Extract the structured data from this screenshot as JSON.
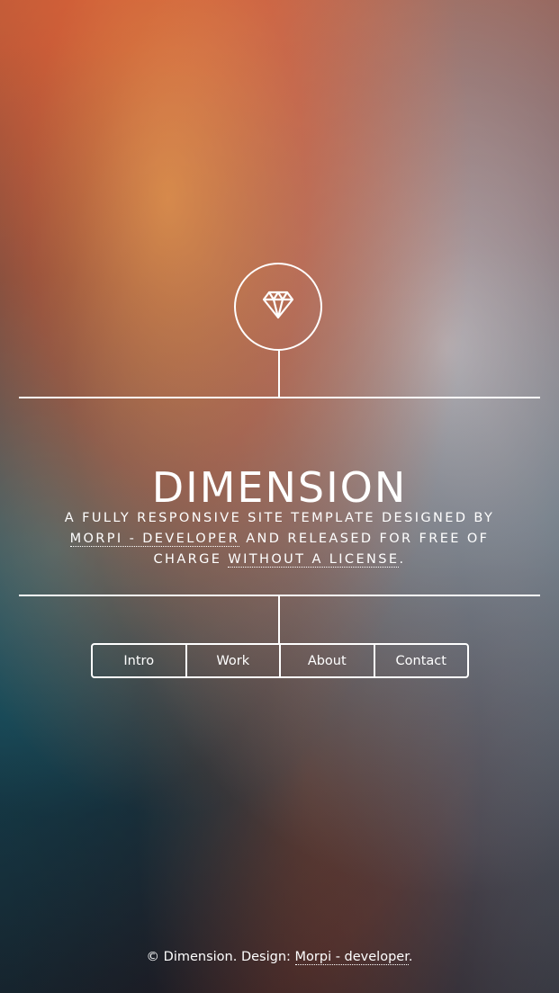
{
  "site": {
    "logo_icon": "diamond-icon",
    "title": "DIMENSION",
    "description": {
      "part1": "A fully responsive site template designed by ",
      "link1": "Morpi - developer",
      "part2": " and released for free of charge ",
      "link2": "without a license",
      "part3": "."
    }
  },
  "nav": {
    "items": [
      "Intro",
      "Work",
      "About",
      "Contact"
    ]
  },
  "footer": {
    "copyright": "© Dimension. Design: ",
    "link": "Morpi - developer",
    "end": "."
  }
}
